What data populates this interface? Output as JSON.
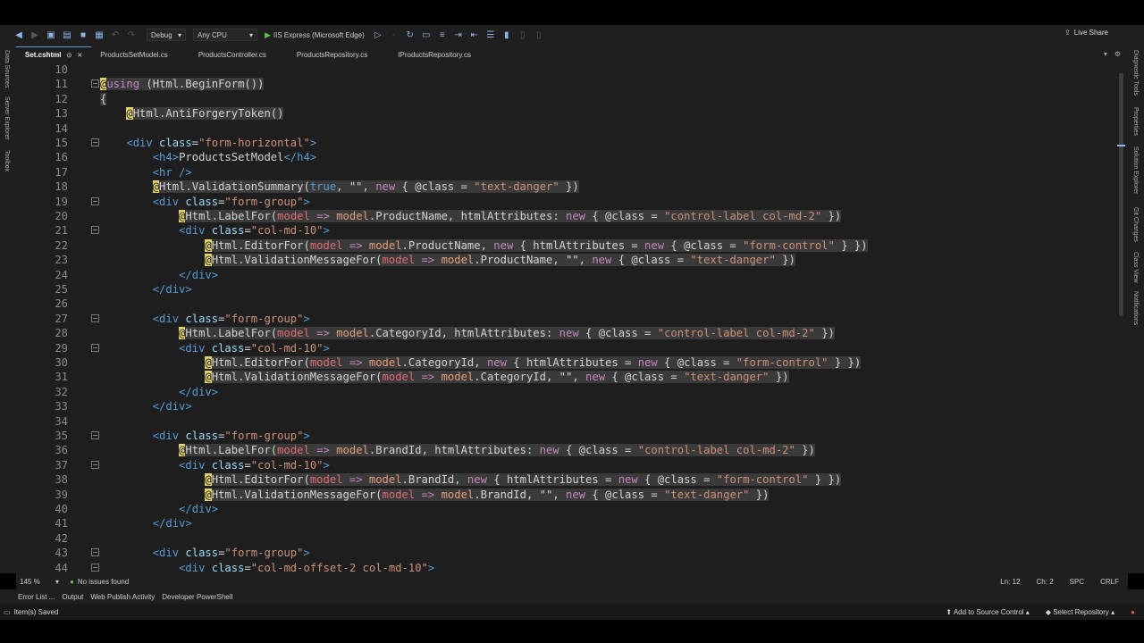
{
  "toolbar": {
    "config": "Debug",
    "platform": "Any CPU",
    "run_target": "IIS Express (Microsoft Edge)",
    "live_share": "Live Share"
  },
  "left_tools": [
    "Data Sources",
    "Server Explorer",
    "Toolbox"
  ],
  "right_tools": [
    "Diagnostic Tools",
    "Properties",
    "Solution Explorer",
    "Git Changes",
    "Class View",
    "Notifications"
  ],
  "tabs": [
    {
      "label": "Set.cshtml",
      "active": true
    },
    {
      "label": "ProductsSetModel.cs",
      "active": false
    },
    {
      "label": "ProductsController.cs",
      "active": false
    },
    {
      "label": "ProductsRepository.cs",
      "active": false
    },
    {
      "label": "IProductsRepository.cs",
      "active": false
    }
  ],
  "code_lines": [
    {
      "n": "10",
      "fold": "",
      "segs": []
    },
    {
      "n": "11",
      "fold": "−",
      "segs": [
        [
          "@",
          "at"
        ],
        [
          "using",
          "kw hl"
        ],
        [
          " (Html.BeginForm())",
          "t hl"
        ]
      ]
    },
    {
      "n": "12",
      "fold": "",
      "segs": [
        [
          "{",
          "t hl"
        ]
      ]
    },
    {
      "n": "13",
      "fold": "",
      "segs": [
        [
          "    ",
          "t"
        ],
        [
          "@",
          "at"
        ],
        [
          "Html.AntiForgeryToken()",
          "t hl"
        ]
      ]
    },
    {
      "n": "14",
      "fold": "",
      "segs": []
    },
    {
      "n": "15",
      "fold": "−",
      "segs": [
        [
          "    ",
          "t"
        ],
        [
          "<div ",
          "tag"
        ],
        [
          "class",
          "attr"
        ],
        [
          "=",
          "t"
        ],
        [
          "\"form-horizontal\"",
          "str"
        ],
        [
          ">",
          "tag"
        ]
      ]
    },
    {
      "n": "16",
      "fold": "",
      "segs": [
        [
          "        ",
          "t"
        ],
        [
          "<h4>",
          "tag"
        ],
        [
          "ProductsSetModel",
          "t"
        ],
        [
          "</h4>",
          "tag"
        ]
      ]
    },
    {
      "n": "17",
      "fold": "",
      "segs": [
        [
          "        ",
          "t"
        ],
        [
          "<hr />",
          "tag"
        ]
      ]
    },
    {
      "n": "18",
      "fold": "",
      "segs": [
        [
          "        ",
          "t"
        ],
        [
          "@",
          "at"
        ],
        [
          "Html.ValidationSummary(",
          "t hl"
        ],
        [
          "true",
          "kwb hl"
        ],
        [
          ", \"\", ",
          "t hl"
        ],
        [
          "new",
          "kw hl"
        ],
        [
          " { @class = ",
          "t hl"
        ],
        [
          "\"text-danger\"",
          "str hl"
        ],
        [
          " })",
          "t hl"
        ]
      ]
    },
    {
      "n": "19",
      "fold": "−",
      "segs": [
        [
          "        ",
          "t"
        ],
        [
          "<div ",
          "tag"
        ],
        [
          "class",
          "attr"
        ],
        [
          "=",
          "t"
        ],
        [
          "\"form-group\"",
          "str"
        ],
        [
          ">",
          "tag"
        ]
      ]
    },
    {
      "n": "20",
      "fold": "",
      "segs": [
        [
          "            ",
          "t"
        ],
        [
          "@",
          "at"
        ],
        [
          "Html.LabelFor(",
          "t hl"
        ],
        [
          "model",
          "prm hl"
        ],
        [
          " => ",
          "kw hl"
        ],
        [
          "model",
          "mdl hl"
        ],
        [
          ".ProductName, htmlAttributes: ",
          "t hl"
        ],
        [
          "new",
          "kw hl"
        ],
        [
          " { @class = ",
          "t hl"
        ],
        [
          "\"control-label col-md-2\"",
          "str hl"
        ],
        [
          " })",
          "t hl"
        ]
      ]
    },
    {
      "n": "21",
      "fold": "−",
      "segs": [
        [
          "            ",
          "t"
        ],
        [
          "<div ",
          "tag"
        ],
        [
          "class",
          "attr"
        ],
        [
          "=",
          "t"
        ],
        [
          "\"col-md-10\"",
          "str"
        ],
        [
          ">",
          "tag"
        ]
      ]
    },
    {
      "n": "22",
      "fold": "",
      "segs": [
        [
          "                ",
          "t"
        ],
        [
          "@",
          "at"
        ],
        [
          "Html.EditorFor(",
          "t hl"
        ],
        [
          "model",
          "prm hl"
        ],
        [
          " => ",
          "kw hl"
        ],
        [
          "model",
          "mdl hl"
        ],
        [
          ".ProductName, ",
          "t hl"
        ],
        [
          "new",
          "kw hl"
        ],
        [
          " { htmlAttributes = ",
          "t hl"
        ],
        [
          "new",
          "kw hl"
        ],
        [
          " { @class = ",
          "t hl"
        ],
        [
          "\"form-control\"",
          "str hl"
        ],
        [
          " } })",
          "t hl"
        ]
      ]
    },
    {
      "n": "23",
      "fold": "",
      "segs": [
        [
          "                ",
          "t"
        ],
        [
          "@",
          "at"
        ],
        [
          "Html.ValidationMessageFor(",
          "t hl"
        ],
        [
          "model",
          "prm hl"
        ],
        [
          " => ",
          "kw hl"
        ],
        [
          "model",
          "mdl hl"
        ],
        [
          ".ProductName, \"\", ",
          "t hl"
        ],
        [
          "new",
          "kw hl"
        ],
        [
          " { @class = ",
          "t hl"
        ],
        [
          "\"text-danger\"",
          "str hl"
        ],
        [
          " })",
          "t hl"
        ]
      ]
    },
    {
      "n": "24",
      "fold": "",
      "segs": [
        [
          "            ",
          "t"
        ],
        [
          "</div>",
          "tag"
        ]
      ]
    },
    {
      "n": "25",
      "fold": "",
      "segs": [
        [
          "        ",
          "t"
        ],
        [
          "</div>",
          "tag"
        ]
      ]
    },
    {
      "n": "26",
      "fold": "",
      "segs": []
    },
    {
      "n": "27",
      "fold": "−",
      "segs": [
        [
          "        ",
          "t"
        ],
        [
          "<div ",
          "tag"
        ],
        [
          "class",
          "attr"
        ],
        [
          "=",
          "t"
        ],
        [
          "\"form-group\"",
          "str"
        ],
        [
          ">",
          "tag"
        ]
      ]
    },
    {
      "n": "28",
      "fold": "",
      "segs": [
        [
          "            ",
          "t"
        ],
        [
          "@",
          "at"
        ],
        [
          "Html.LabelFor(",
          "t hl"
        ],
        [
          "model",
          "prm hl"
        ],
        [
          " => ",
          "kw hl"
        ],
        [
          "model",
          "mdl hl"
        ],
        [
          ".CategoryId, htmlAttributes: ",
          "t hl"
        ],
        [
          "new",
          "kw hl"
        ],
        [
          " { @class = ",
          "t hl"
        ],
        [
          "\"control-label col-md-2\"",
          "str hl"
        ],
        [
          " })",
          "t hl"
        ]
      ]
    },
    {
      "n": "29",
      "fold": "−",
      "segs": [
        [
          "            ",
          "t"
        ],
        [
          "<div ",
          "tag"
        ],
        [
          "class",
          "attr"
        ],
        [
          "=",
          "t"
        ],
        [
          "\"col-md-10\"",
          "str"
        ],
        [
          ">",
          "tag"
        ]
      ]
    },
    {
      "n": "30",
      "fold": "",
      "segs": [
        [
          "                ",
          "t"
        ],
        [
          "@",
          "at"
        ],
        [
          "Html.EditorFor(",
          "t hl"
        ],
        [
          "model",
          "prm hl"
        ],
        [
          " => ",
          "kw hl"
        ],
        [
          "model",
          "mdl hl"
        ],
        [
          ".CategoryId, ",
          "t hl"
        ],
        [
          "new",
          "kw hl"
        ],
        [
          " { htmlAttributes = ",
          "t hl"
        ],
        [
          "new",
          "kw hl"
        ],
        [
          " { @class = ",
          "t hl"
        ],
        [
          "\"form-control\"",
          "str hl"
        ],
        [
          " } })",
          "t hl"
        ]
      ]
    },
    {
      "n": "31",
      "fold": "",
      "segs": [
        [
          "                ",
          "t"
        ],
        [
          "@",
          "at"
        ],
        [
          "Html.ValidationMessageFor(",
          "t hl"
        ],
        [
          "model",
          "prm hl"
        ],
        [
          " => ",
          "kw hl"
        ],
        [
          "model",
          "mdl hl"
        ],
        [
          ".CategoryId, \"\", ",
          "t hl"
        ],
        [
          "new",
          "kw hl"
        ],
        [
          " { @class = ",
          "t hl"
        ],
        [
          "\"text-danger\"",
          "str hl"
        ],
        [
          " })",
          "t hl"
        ]
      ]
    },
    {
      "n": "32",
      "fold": "",
      "segs": [
        [
          "            ",
          "t"
        ],
        [
          "</div>",
          "tag"
        ]
      ]
    },
    {
      "n": "33",
      "fold": "",
      "segs": [
        [
          "        ",
          "t"
        ],
        [
          "</div>",
          "tag"
        ]
      ]
    },
    {
      "n": "34",
      "fold": "",
      "segs": []
    },
    {
      "n": "35",
      "fold": "−",
      "segs": [
        [
          "        ",
          "t"
        ],
        [
          "<div ",
          "tag"
        ],
        [
          "class",
          "attr"
        ],
        [
          "=",
          "t"
        ],
        [
          "\"form-group\"",
          "str"
        ],
        [
          ">",
          "tag"
        ]
      ]
    },
    {
      "n": "36",
      "fold": "",
      "segs": [
        [
          "            ",
          "t"
        ],
        [
          "@",
          "at"
        ],
        [
          "Html.LabelFor(",
          "t hl"
        ],
        [
          "model",
          "prm hl"
        ],
        [
          " => ",
          "kw hl"
        ],
        [
          "model",
          "mdl hl"
        ],
        [
          ".BrandId, htmlAttributes: ",
          "t hl"
        ],
        [
          "new",
          "kw hl"
        ],
        [
          " { @class = ",
          "t hl"
        ],
        [
          "\"control-label col-md-2\"",
          "str hl"
        ],
        [
          " })",
          "t hl"
        ]
      ]
    },
    {
      "n": "37",
      "fold": "−",
      "segs": [
        [
          "            ",
          "t"
        ],
        [
          "<div ",
          "tag"
        ],
        [
          "class",
          "attr"
        ],
        [
          "=",
          "t"
        ],
        [
          "\"col-md-10\"",
          "str"
        ],
        [
          ">",
          "tag"
        ]
      ]
    },
    {
      "n": "38",
      "fold": "",
      "segs": [
        [
          "                ",
          "t"
        ],
        [
          "@",
          "at"
        ],
        [
          "Html.EditorFor(",
          "t hl"
        ],
        [
          "model",
          "prm hl"
        ],
        [
          " => ",
          "kw hl"
        ],
        [
          "model",
          "mdl hl"
        ],
        [
          ".BrandId, ",
          "t hl"
        ],
        [
          "new",
          "kw hl"
        ],
        [
          " { htmlAttributes = ",
          "t hl"
        ],
        [
          "new",
          "kw hl"
        ],
        [
          " { @class = ",
          "t hl"
        ],
        [
          "\"form-control\"",
          "str hl"
        ],
        [
          " } })",
          "t hl"
        ]
      ]
    },
    {
      "n": "39",
      "fold": "",
      "segs": [
        [
          "                ",
          "t"
        ],
        [
          "@",
          "at"
        ],
        [
          "Html.ValidationMessageFor(",
          "t hl"
        ],
        [
          "model",
          "prm hl"
        ],
        [
          " => ",
          "kw hl"
        ],
        [
          "model",
          "mdl hl"
        ],
        [
          ".BrandId, \"\", ",
          "t hl"
        ],
        [
          "new",
          "kw hl"
        ],
        [
          " { @class = ",
          "t hl"
        ],
        [
          "\"text-danger\"",
          "str hl"
        ],
        [
          " })",
          "t hl"
        ]
      ]
    },
    {
      "n": "40",
      "fold": "",
      "segs": [
        [
          "            ",
          "t"
        ],
        [
          "</div>",
          "tag"
        ]
      ]
    },
    {
      "n": "41",
      "fold": "",
      "segs": [
        [
          "        ",
          "t"
        ],
        [
          "</div>",
          "tag"
        ]
      ]
    },
    {
      "n": "42",
      "fold": "",
      "segs": []
    },
    {
      "n": "43",
      "fold": "−",
      "segs": [
        [
          "        ",
          "t"
        ],
        [
          "<div ",
          "tag"
        ],
        [
          "class",
          "attr"
        ],
        [
          "=",
          "t"
        ],
        [
          "\"form-group\"",
          "str"
        ],
        [
          ">",
          "tag"
        ]
      ]
    },
    {
      "n": "44",
      "fold": "−",
      "segs": [
        [
          "            ",
          "t"
        ],
        [
          "<div ",
          "tag"
        ],
        [
          "class",
          "attr"
        ],
        [
          "=",
          "t"
        ],
        [
          "\"col-md-offset-2 col-md-10\"",
          "str"
        ],
        [
          ">",
          "tag"
        ]
      ]
    }
  ],
  "status_row": {
    "zoom": "145 %",
    "issues": "No issues found",
    "ln": "Ln: 12",
    "ch": "Ch: 2",
    "spc": "SPC",
    "eol": "CRLF"
  },
  "panel_tabs": [
    "Error List ...",
    "Output",
    "Web Publish Activity",
    "Developer PowerShell"
  ],
  "status": {
    "message": "Item(s) Saved",
    "source_control": "Add to Source Control",
    "repo": "Select Repository"
  }
}
